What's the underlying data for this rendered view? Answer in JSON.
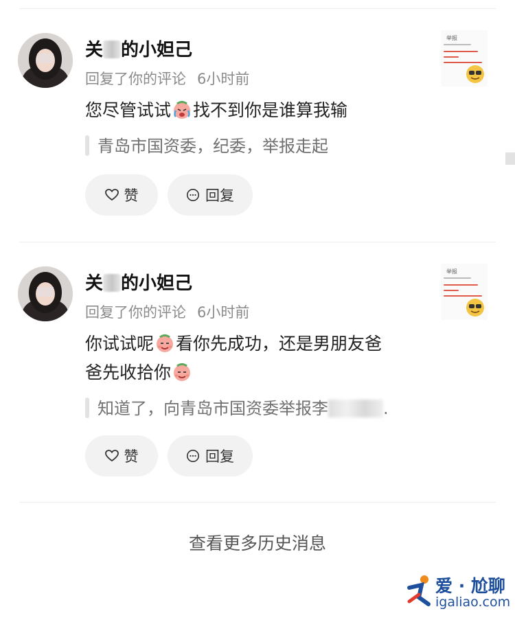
{
  "notifications": [
    {
      "username_prefix": "关",
      "username_suffix": "的小妲己",
      "action": "回复了你的评论",
      "time": "6小时前",
      "message_line1_a": "您尽管试试",
      "message_line1_b": "找不到你是谁算我输",
      "message_line2_a": "",
      "message_line2_b": "",
      "quoted": "青岛市国资委，纪委，举报走起",
      "quoted_tail": "",
      "like_label": "赞",
      "reply_label": "回复"
    },
    {
      "username_prefix": "关",
      "username_suffix": "的小妲己",
      "action": "回复了你的评论",
      "time": "6小时前",
      "message_line1_a": "你试试呢",
      "message_line1_b": "看你先成功，还是男朋友爸",
      "message_line2_a": "爸先收拾你",
      "message_line2_b": "",
      "quoted": "知道了，向青岛市国资委举报李",
      "quoted_tail": ".",
      "like_label": "赞",
      "reply_label": "回复"
    }
  ],
  "thumbnail": {
    "title": "举报"
  },
  "footer": {
    "more_label": "查看更多历史消息"
  },
  "watermark": {
    "brand": "爱 · 尬聊",
    "url": "igaliao.com"
  },
  "colors": {
    "button_bg": "#f2f2f2",
    "accent_text": "#111111",
    "muted_text": "#8a8a8a",
    "watermark": "#1e4f9c"
  },
  "icons": [
    "heart-icon",
    "comment-icon",
    "sob-emoji-icon",
    "smug-emoji-icon",
    "cool-face-icon"
  ]
}
